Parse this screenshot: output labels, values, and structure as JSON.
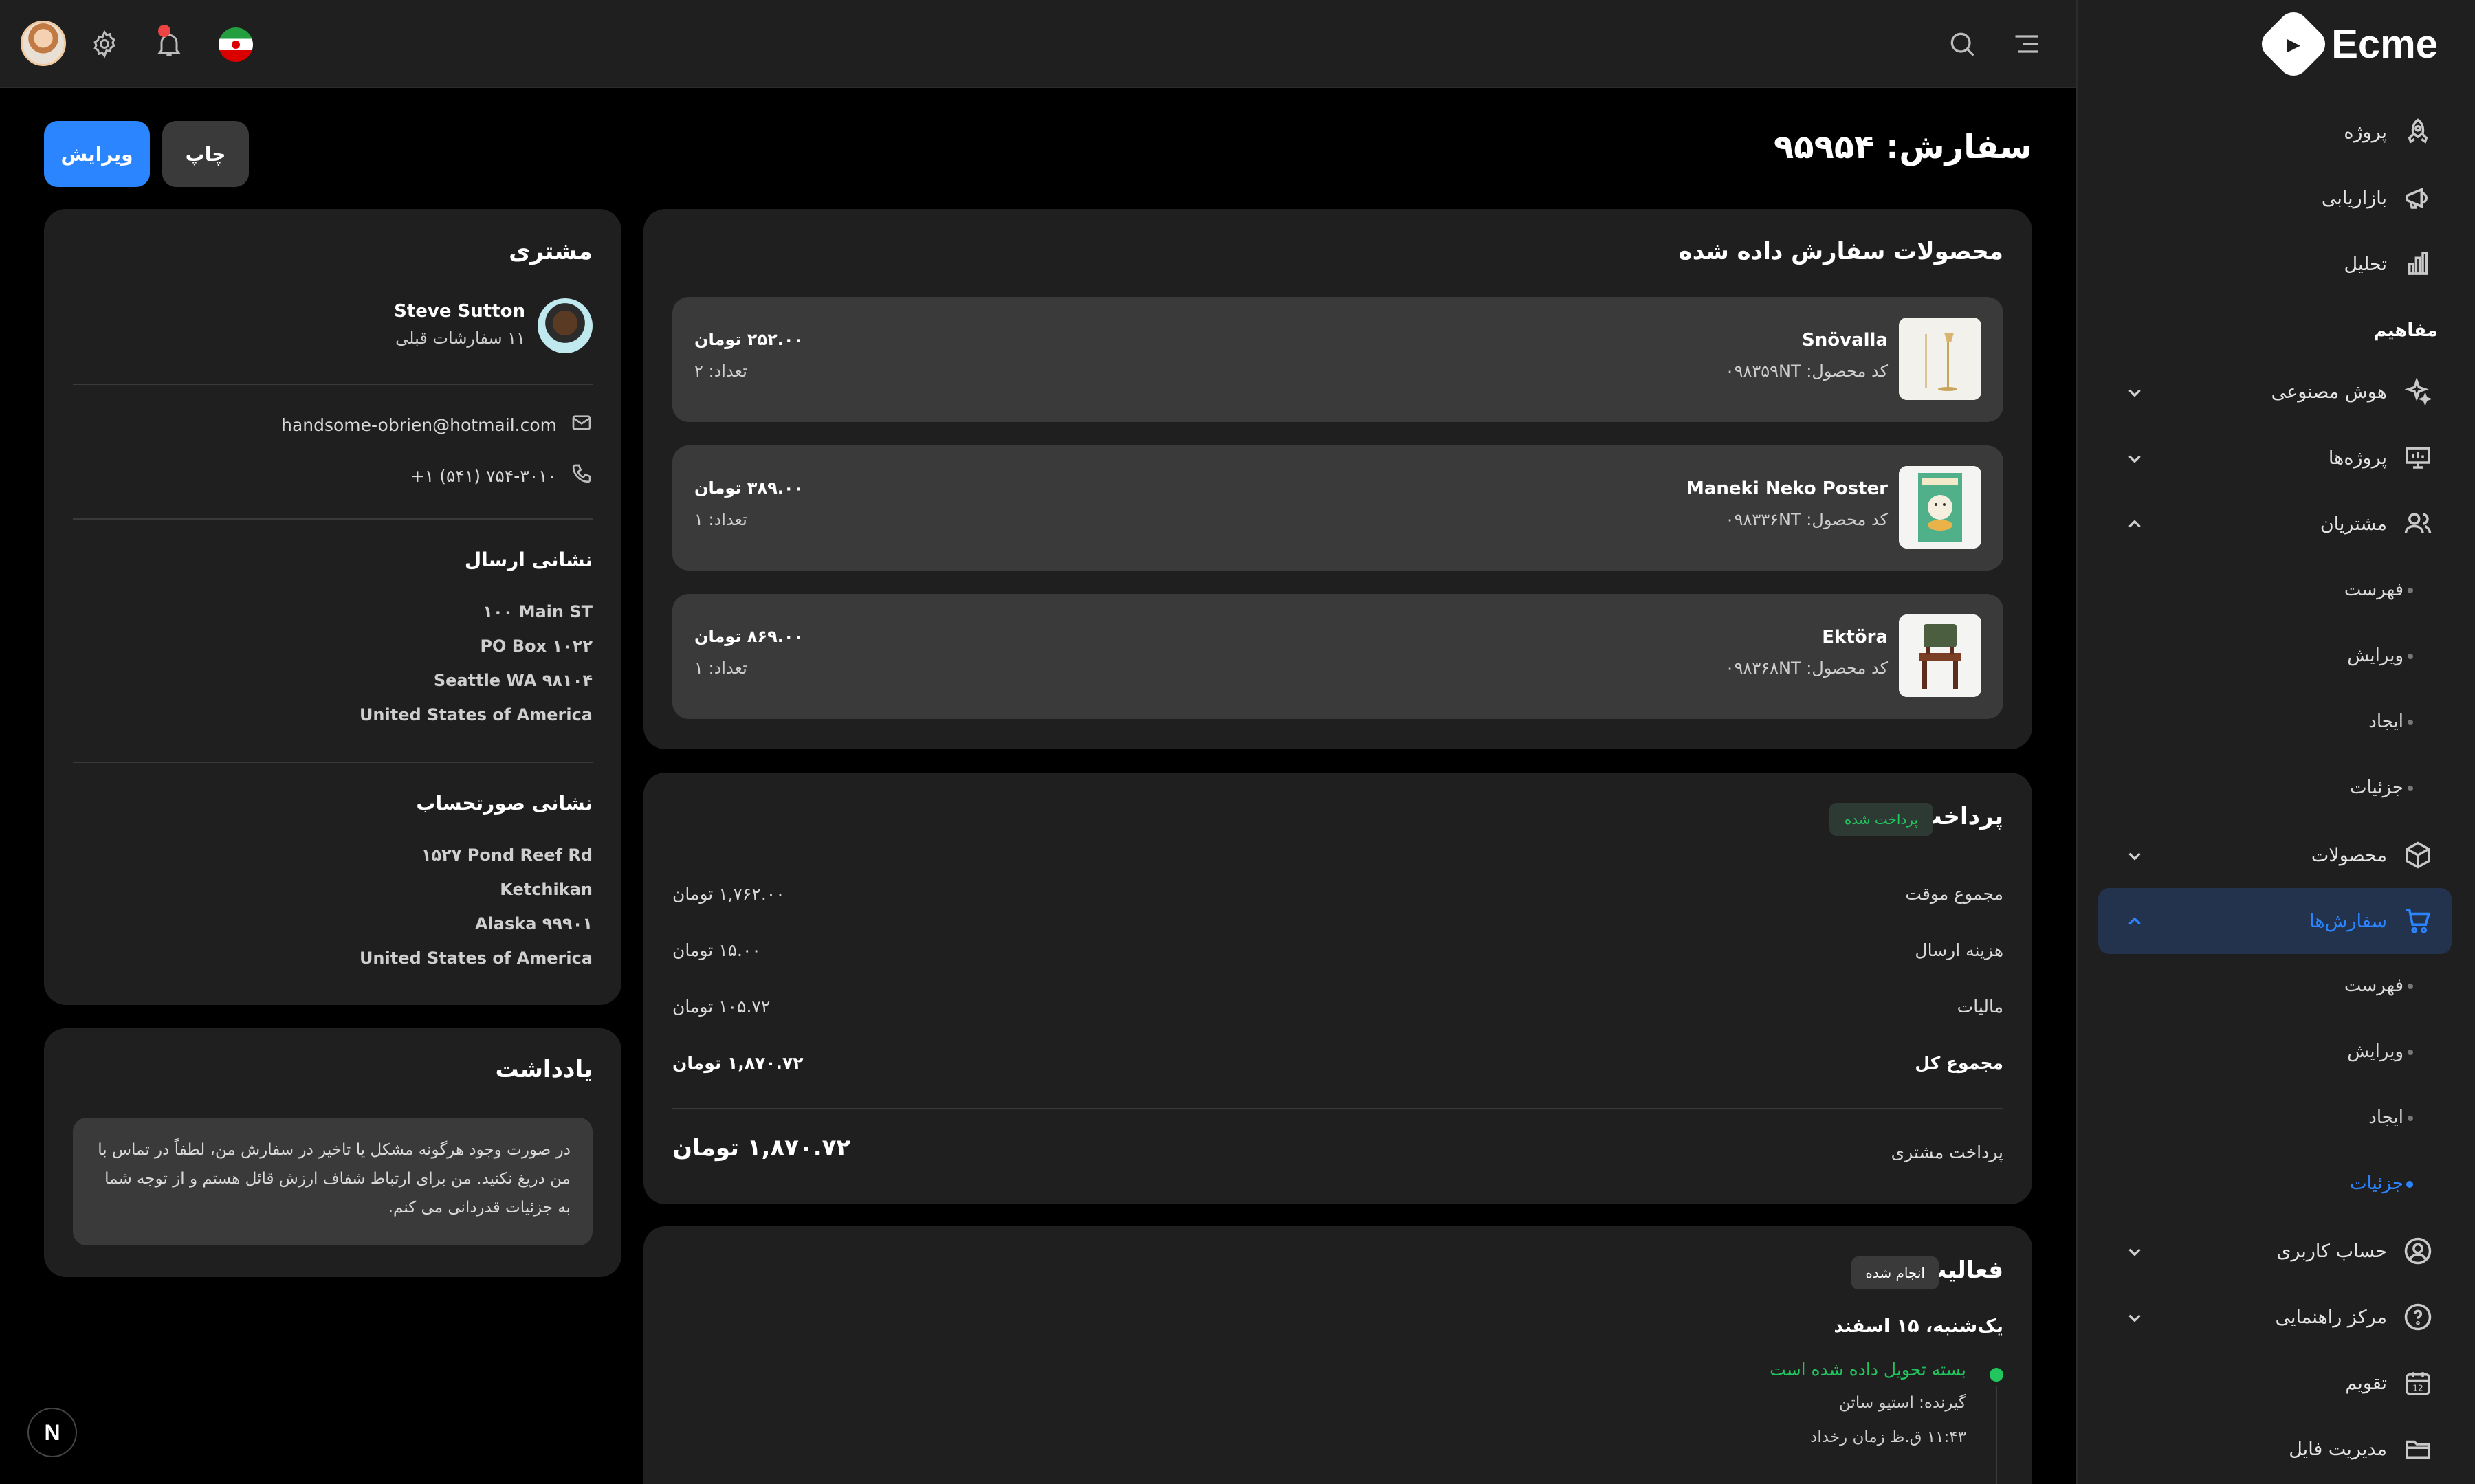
{
  "header": {
    "language_flag": "iran-flag",
    "notifications_has_dot": true,
    "icons": [
      "search-icon",
      "menu-icon",
      "bell-icon",
      "gear-icon",
      "avatar"
    ]
  },
  "sidebar": {
    "logo_text": "Ecme",
    "items": [
      {
        "label": "پروژه",
        "icon": "rocket-icon"
      },
      {
        "label": "بازاریابی",
        "icon": "megaphone-icon"
      },
      {
        "label": "تحلیل",
        "icon": "bar-chart-icon"
      }
    ],
    "heading": "مفاهیم",
    "groups": [
      {
        "label": "هوش مصنوعی",
        "icon": "sparkle-icon"
      },
      {
        "label": "پروژه‌ها",
        "icon": "presentation-icon"
      },
      {
        "label": "مشتریان",
        "icon": "users-icon"
      }
    ],
    "customers_sub": [
      "فهرست",
      "ویرایش",
      "ایجاد",
      "جزئیات"
    ],
    "products_label": "محصولات",
    "orders_label": "سفارش‌ها",
    "orders_sub": [
      "فهرست",
      "ویرایش",
      "ایجاد",
      "جزئیات"
    ],
    "bottom": [
      {
        "label": "حساب کاربری",
        "icon": "user-circle-icon"
      },
      {
        "label": "مرکز راهنمایی",
        "icon": "help-circle-icon"
      },
      {
        "label": "تقویم",
        "icon": "calendar-icon",
        "badge": "12"
      },
      {
        "label": "مدیریت فایل",
        "icon": "folder-icon"
      }
    ]
  },
  "page": {
    "title": "سفارش: ۹۵۹۵۴",
    "edit_label": "ویرایش",
    "print_label": "چاپ"
  },
  "products": {
    "title": "محصولات سفارش داده شده",
    "items": [
      {
        "name": "Snövalla",
        "code": "کد محصول: ۰۹۸۳۵۹NT",
        "price": "۲۵۲.۰۰ تومان",
        "qty": "تعداد: ۲"
      },
      {
        "name": "Maneki Neko Poster",
        "code": "کد محصول: ۰۹۸۳۳۶NT",
        "price": "۳۸۹.۰۰ تومان",
        "qty": "تعداد: ۱"
      },
      {
        "name": "Ektöra",
        "code": "کد محصول: ۰۹۸۳۶۸NT",
        "price": "۸۶۹.۰۰ تومان",
        "qty": "تعداد: ۱"
      }
    ]
  },
  "payment": {
    "title": "پرداخت",
    "status": "پرداخت شده",
    "rows": [
      {
        "label": "مجموع موقت",
        "value": "۱,۷۶۲.۰۰ تومان"
      },
      {
        "label": "هزینه ارسال",
        "value": "۱۵.۰۰ تومان"
      },
      {
        "label": "مالیات",
        "value": "۱۰۵.۷۲ تومان"
      },
      {
        "label": "مجموع کل",
        "value": "۱,۸۷۰.۷۲ تومان"
      }
    ],
    "customer_paid_label": "پرداخت مشتری",
    "customer_paid_value": "۱,۸۷۰.۷۲ تومان"
  },
  "activity": {
    "title": "فعالیت",
    "status": "انجام شده",
    "date": "یک‌شنبه، ۱۵ اسفند",
    "event": "بسته تحویل داده شده است",
    "recipient": "گیرنده: استیو ساتن",
    "time": "۱۱:۴۳ ق.ظ زمان رخداد"
  },
  "customer": {
    "title": "مشتری",
    "name": "Steve Sutton",
    "orders": "۱۱ سفارشات قبلی",
    "email": "handsome-obrien@hotmail.com",
    "phone": "+۱ (۵۴۱) ۷۵۴-۳۰۱۰",
    "shipping_title": "نشانی ارسال",
    "shipping": [
      "۱۰۰ Main ST",
      "PO Box ۱۰۲۲",
      "Seattle WA ۹۸۱۰۴",
      "United States of America"
    ],
    "billing_title": "نشانی صورتحساب",
    "billing": [
      "۱۵۲۷ Pond Reef Rd",
      "Ketchikan",
      "Alaska ۹۹۹۰۱",
      "United States of America"
    ]
  },
  "note": {
    "title": "یادداشت",
    "text": "در صورت وجود هرگونه مشکل یا تاخیر در سفارش من، لطفاً در تماس با من دریغ نکنید. من برای ارتباط شفاف ارزش قائل هستم و از توجه شما به جزئیات قدردانی می کنم."
  },
  "floating_badge": "N"
}
